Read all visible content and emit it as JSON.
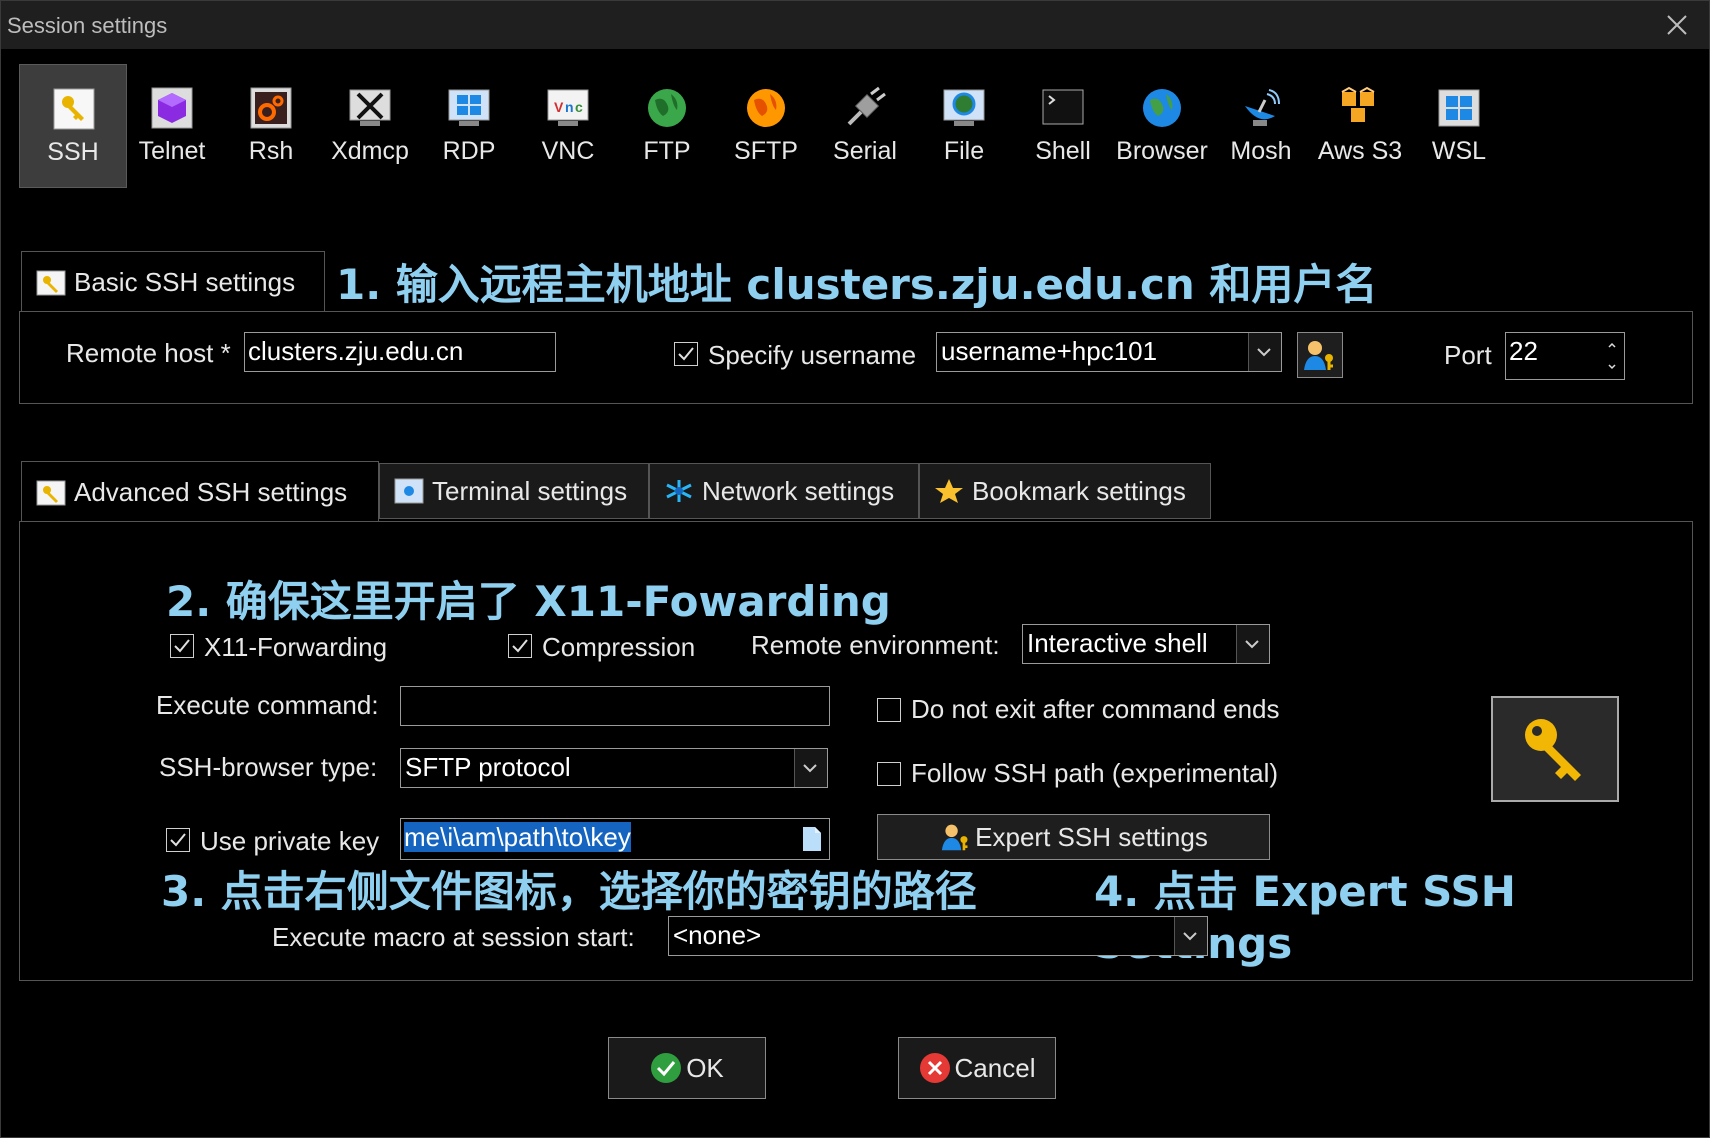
{
  "window": {
    "title": "Session settings"
  },
  "toolbar": {
    "items": [
      {
        "label": "SSH",
        "icon": "ssh-key-icon"
      },
      {
        "label": "Telnet",
        "icon": "telnet-icon"
      },
      {
        "label": "Rsh",
        "icon": "rsh-icon"
      },
      {
        "label": "Xdmcp",
        "icon": "xdmcp-icon"
      },
      {
        "label": "RDP",
        "icon": "rdp-icon"
      },
      {
        "label": "VNC",
        "icon": "vnc-icon"
      },
      {
        "label": "FTP",
        "icon": "ftp-globe-icon"
      },
      {
        "label": "SFTP",
        "icon": "sftp-globe-icon"
      },
      {
        "label": "Serial",
        "icon": "serial-plug-icon"
      },
      {
        "label": "File",
        "icon": "file-monitor-icon"
      },
      {
        "label": "Shell",
        "icon": "shell-terminal-icon"
      },
      {
        "label": "Browser",
        "icon": "browser-globe-icon"
      },
      {
        "label": "Mosh",
        "icon": "mosh-satellite-icon"
      },
      {
        "label": "Aws S3",
        "icon": "aws-s3-boxes-icon"
      },
      {
        "label": "WSL",
        "icon": "wsl-windows-icon"
      }
    ],
    "active": "SSH"
  },
  "basic": {
    "tab_label": "Basic SSH settings",
    "remote_host_label": "Remote host *",
    "remote_host_value": "clusters.zju.edu.cn",
    "specify_username_label": "Specify username",
    "specify_username_checked": true,
    "username_value": "username+hpc101",
    "port_label": "Port",
    "port_value": "22"
  },
  "advanced_tabs": [
    {
      "label": "Advanced SSH settings",
      "icon": "wrench-key-icon",
      "selected": true
    },
    {
      "label": "Terminal settings",
      "icon": "terminal-gear-icon",
      "selected": false
    },
    {
      "label": "Network settings",
      "icon": "network-star-icon",
      "selected": false
    },
    {
      "label": "Bookmark settings",
      "icon": "star-icon",
      "selected": false
    }
  ],
  "advanced": {
    "x11_label": "X11-Forwarding",
    "x11_checked": true,
    "compression_label": "Compression",
    "compression_checked": true,
    "remote_env_label": "Remote environment:",
    "remote_env_value": "Interactive shell",
    "execute_command_label": "Execute command:",
    "execute_command_value": "",
    "no_exit_label": "Do not exit after command ends",
    "no_exit_checked": false,
    "ssh_browser_label": "SSH-browser type:",
    "ssh_browser_value": "SFTP protocol",
    "follow_path_label": "Follow SSH path (experimental)",
    "follow_path_checked": false,
    "private_key_label": "Use private key",
    "private_key_checked": true,
    "private_key_value": "me\\i\\am\\path\\to\\key",
    "expert_button_label": "Expert SSH settings",
    "macro_label": "Execute macro at session start:",
    "macro_value": "<none>"
  },
  "annotations": {
    "step1": "1. 输入远程主机地址 clusters.zju.edu.cn 和用户名",
    "step2": "2. 确保这里开启了 X11-Fowarding",
    "step3": "3. 点击右侧文件图标，选择你的密钥的路径",
    "step4": "4. 点击 Expert SSH Settings"
  },
  "footer": {
    "ok_label": "OK",
    "cancel_label": "Cancel"
  },
  "colors": {
    "annotation": "#8fd0f0",
    "selection": "#1565c0",
    "background": "#000000"
  }
}
